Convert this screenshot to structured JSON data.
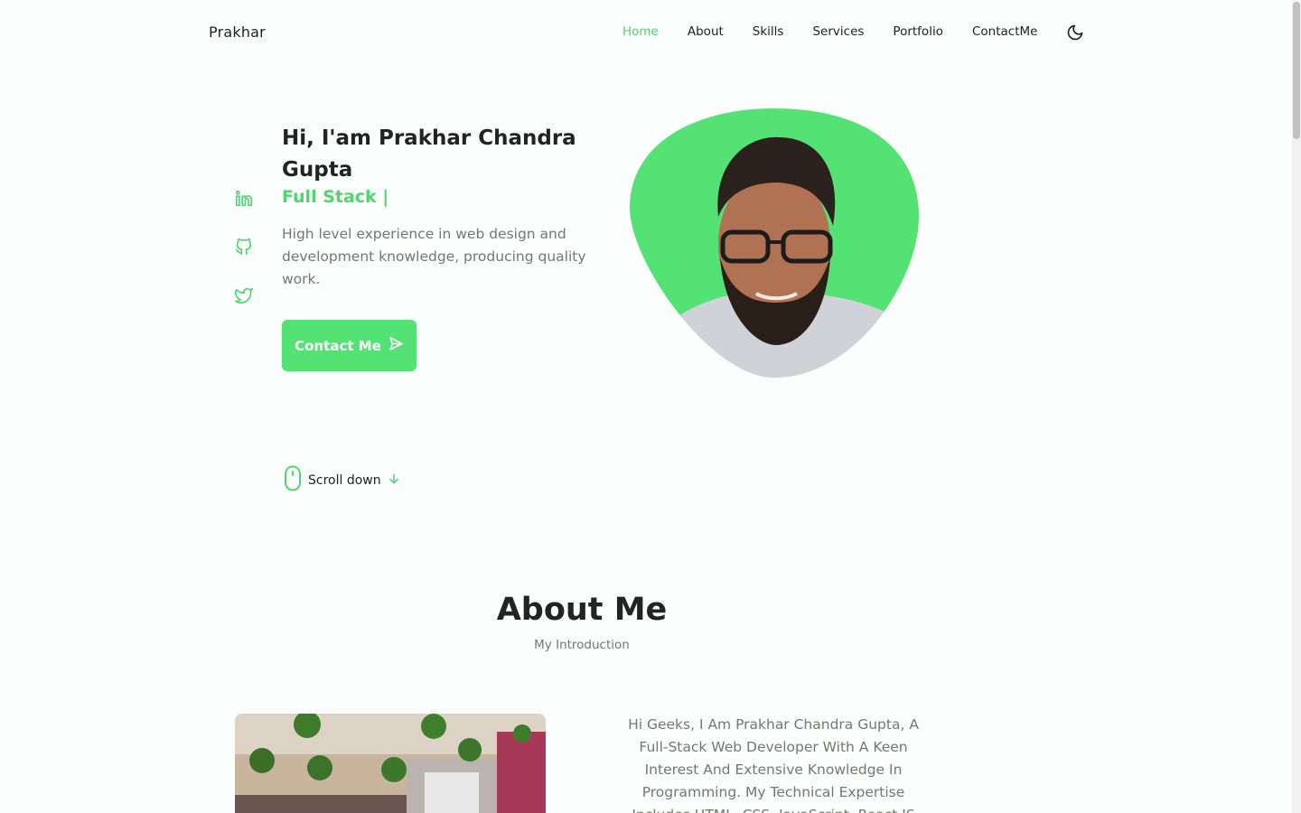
{
  "header": {
    "logo": "Prakhar",
    "nav": [
      "Home",
      "About",
      "Skills",
      "Services",
      "Portfolio",
      "ContactMe"
    ],
    "active_nav": "Home"
  },
  "hero": {
    "title": "Hi, I'am Prakhar Chandra Gupta",
    "subtitle": "Full Stack |",
    "description": "High level experience in web design and development knowledge, producing quality work.",
    "button_label": "Contact Me",
    "scroll_label": "Scroll down",
    "socials": [
      "linkedin-icon",
      "github-icon",
      "twitter-icon"
    ]
  },
  "about": {
    "title": "About Me",
    "subtitle": "My Introduction",
    "text": "Hi Geeks, I Am Prakhar Chandra Gupta, A Full-Stack Web Developer With A Keen Interest And Extensive Knowledge In Programming. My Technical Expertise Includes HTML, CSS, JavaScript, React JS"
  },
  "colors": {
    "accent": "#55e274",
    "accent_text": "#4fd66e",
    "muted_text": "#6b7c72",
    "background": "#fbfefd"
  }
}
